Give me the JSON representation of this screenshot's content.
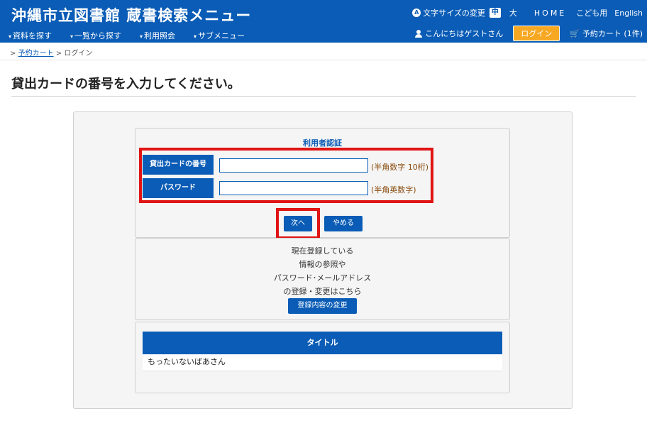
{
  "header": {
    "site_title": "沖縄市立図書館 蔵書検索メニュー",
    "nav": [
      {
        "label": "資料を探す"
      },
      {
        "label": "一覧から探す"
      },
      {
        "label": "利用照会"
      },
      {
        "label": "サブメニュー"
      }
    ],
    "font_size_label": "文字サイズの変更",
    "font_size_mid": "中",
    "font_size_large": "大",
    "home": "HOME",
    "kids": "こども用",
    "english": "English",
    "greeting": "こんにちはゲストさん",
    "login": "ログイン",
    "cart": "予約カート (1件)",
    "caret": "▾",
    "cart_icon": "🛒"
  },
  "breadcrumb": {
    "prefix": ">",
    "link": "予約カート",
    "separator": ">",
    "current": "ログイン"
  },
  "page_title": "貸出カードの番号を入力してください。",
  "auth": {
    "title": "利用者認証",
    "card_label": "貸出カードの番号",
    "card_value": "",
    "card_hint": "(半角数字 10桁)",
    "password_label": "パスワード",
    "password_value": "",
    "password_hint": "(半角英数字)",
    "next_button": "次へ",
    "cancel_button": "やめる"
  },
  "registration": {
    "line1": "現在登録している",
    "line2": "情報の参照や",
    "line3": "パスワード･メールアドレス",
    "line4": "の登録・変更はこちら",
    "button": "登録内容の変更"
  },
  "reservation_list": {
    "column_header": "タイトル",
    "rows": [
      {
        "title": "もったいないばあさん"
      }
    ]
  },
  "colors": {
    "primary": "#0a5cb6",
    "highlight": "#e11414",
    "login_button": "#f7a823"
  }
}
